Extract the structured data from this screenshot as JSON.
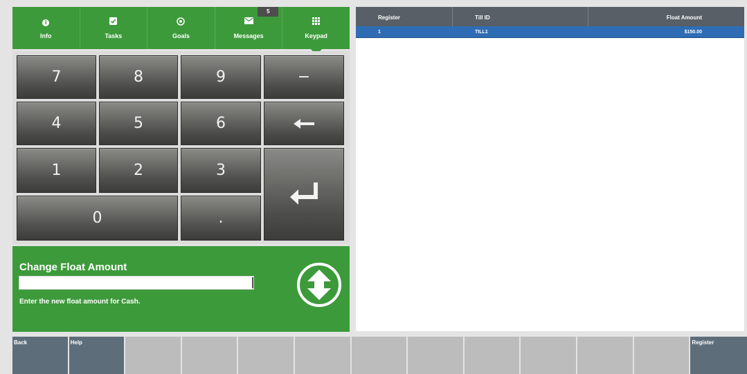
{
  "tabs": [
    {
      "id": "info",
      "label": "Info",
      "icon": "info-icon"
    },
    {
      "id": "tasks",
      "label": "Tasks",
      "icon": "checkbox-icon"
    },
    {
      "id": "goals",
      "label": "Goals",
      "icon": "target-icon"
    },
    {
      "id": "messages",
      "label": "Messages",
      "icon": "envelope-icon",
      "badge": "5"
    },
    {
      "id": "keypad",
      "label": "Keypad",
      "icon": "keypad-icon",
      "active": true
    }
  ],
  "keypad": {
    "keys": {
      "7": "7",
      "8": "8",
      "9": "9",
      "minus": "−",
      "4": "4",
      "5": "5",
      "6": "6",
      "1": "1",
      "2": "2",
      "3": "3",
      "0": "0",
      "dot": "."
    },
    "backspace_icon": "backspace-arrow-icon",
    "enter_icon": "enter-return-icon"
  },
  "prompt": {
    "title": "Change Float Amount",
    "input_value": "",
    "hint": "Enter the new float amount for Cash.",
    "scroll_icon": "up-down-scroll-icon"
  },
  "table": {
    "columns": [
      "Register",
      "Till ID",
      "Float Amount"
    ],
    "rows": [
      {
        "register": "1",
        "till_id": "TILL1",
        "float_amount": "$150.00",
        "selected": true
      }
    ]
  },
  "function_keys": [
    "Back",
    "Help",
    "",
    "",
    "",
    "",
    "",
    "",
    "",
    "",
    "",
    "",
    "Register"
  ],
  "colors": {
    "accent_green": "#3d9a3b",
    "selected_row": "#2e6db4",
    "header_gray": "#585f66",
    "fkey_active": "#5e6d7a",
    "fkey_inactive": "#bcbcbc"
  }
}
